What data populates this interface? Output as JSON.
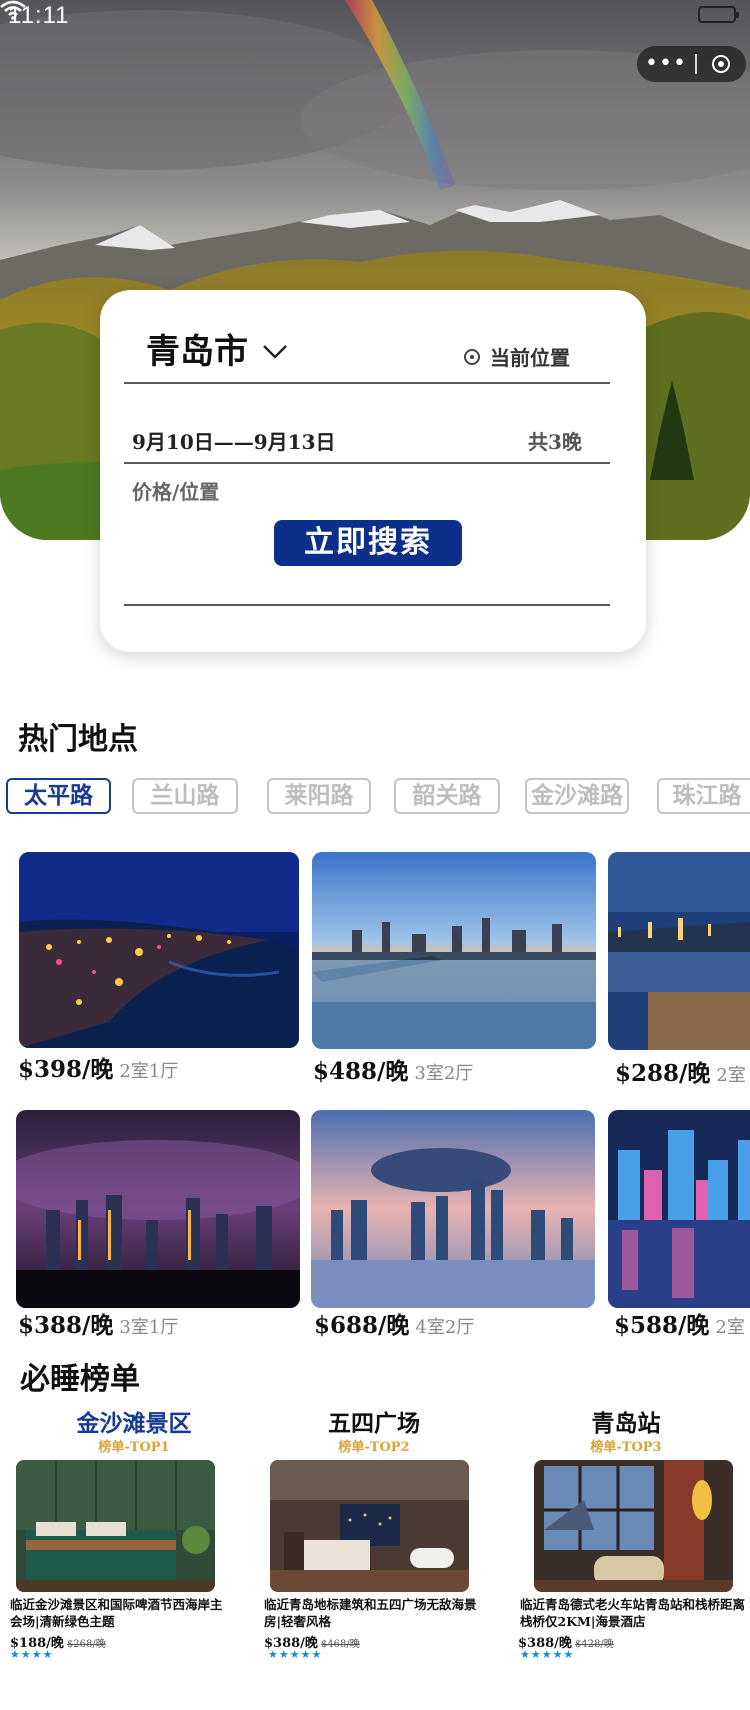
{
  "status": {
    "time": "11:11"
  },
  "search": {
    "city": "青岛市",
    "location_label": "当前位置",
    "dates": "9月10日——9月13日",
    "nights": "共3晚",
    "price_location_placeholder": "价格/位置",
    "search_button": "立即搜索"
  },
  "hot": {
    "title": "热门地点",
    "tabs": [
      "太平路",
      "兰山路",
      "莱阳路",
      "韶关路",
      "金沙滩路",
      "珠江路"
    ],
    "active_tab": "太平路",
    "listings": [
      {
        "price": "$398/晚",
        "room": "2室1厅"
      },
      {
        "price": "$488/晚",
        "room": "3室2厅"
      },
      {
        "price": "$288/晚",
        "room": "2室"
      },
      {
        "price": "$388/晚",
        "room": "3室1厅"
      },
      {
        "price": "$688/晚",
        "room": "4室2厅"
      },
      {
        "price": "$588/晚",
        "room": "2室"
      }
    ]
  },
  "ranking": {
    "title": "必睡榜单",
    "items": [
      {
        "name": "金沙滩景区",
        "tag": "榜单-TOP1",
        "name_color": "#173a93",
        "desc": "临近金沙滩景区和国际啤酒节西海岸主会场|清新绿色主题",
        "price": "$188/晚",
        "old_price": "$268/晚",
        "stars": 4
      },
      {
        "name": "五四广场",
        "tag": "榜单-TOP2",
        "name_color": "#111111",
        "desc": "临近青岛地标建筑和五四广场无敌海景房|轻奢风格",
        "price": "$388/晚",
        "old_price": "$468/晚",
        "stars": 5
      },
      {
        "name": "青岛站",
        "tag": "榜单-TOP3",
        "name_color": "#111111",
        "desc": "临近青岛德式老火车站青岛站和栈桥距离栈桥仅2KM|海景酒店",
        "price": "$388/晚",
        "old_price": "$428/晚",
        "stars": 5
      }
    ]
  },
  "colors": {
    "accent": "#0b2f8a",
    "tag_gold": "#d9a23a",
    "star_blue": "#1a8ad6"
  }
}
